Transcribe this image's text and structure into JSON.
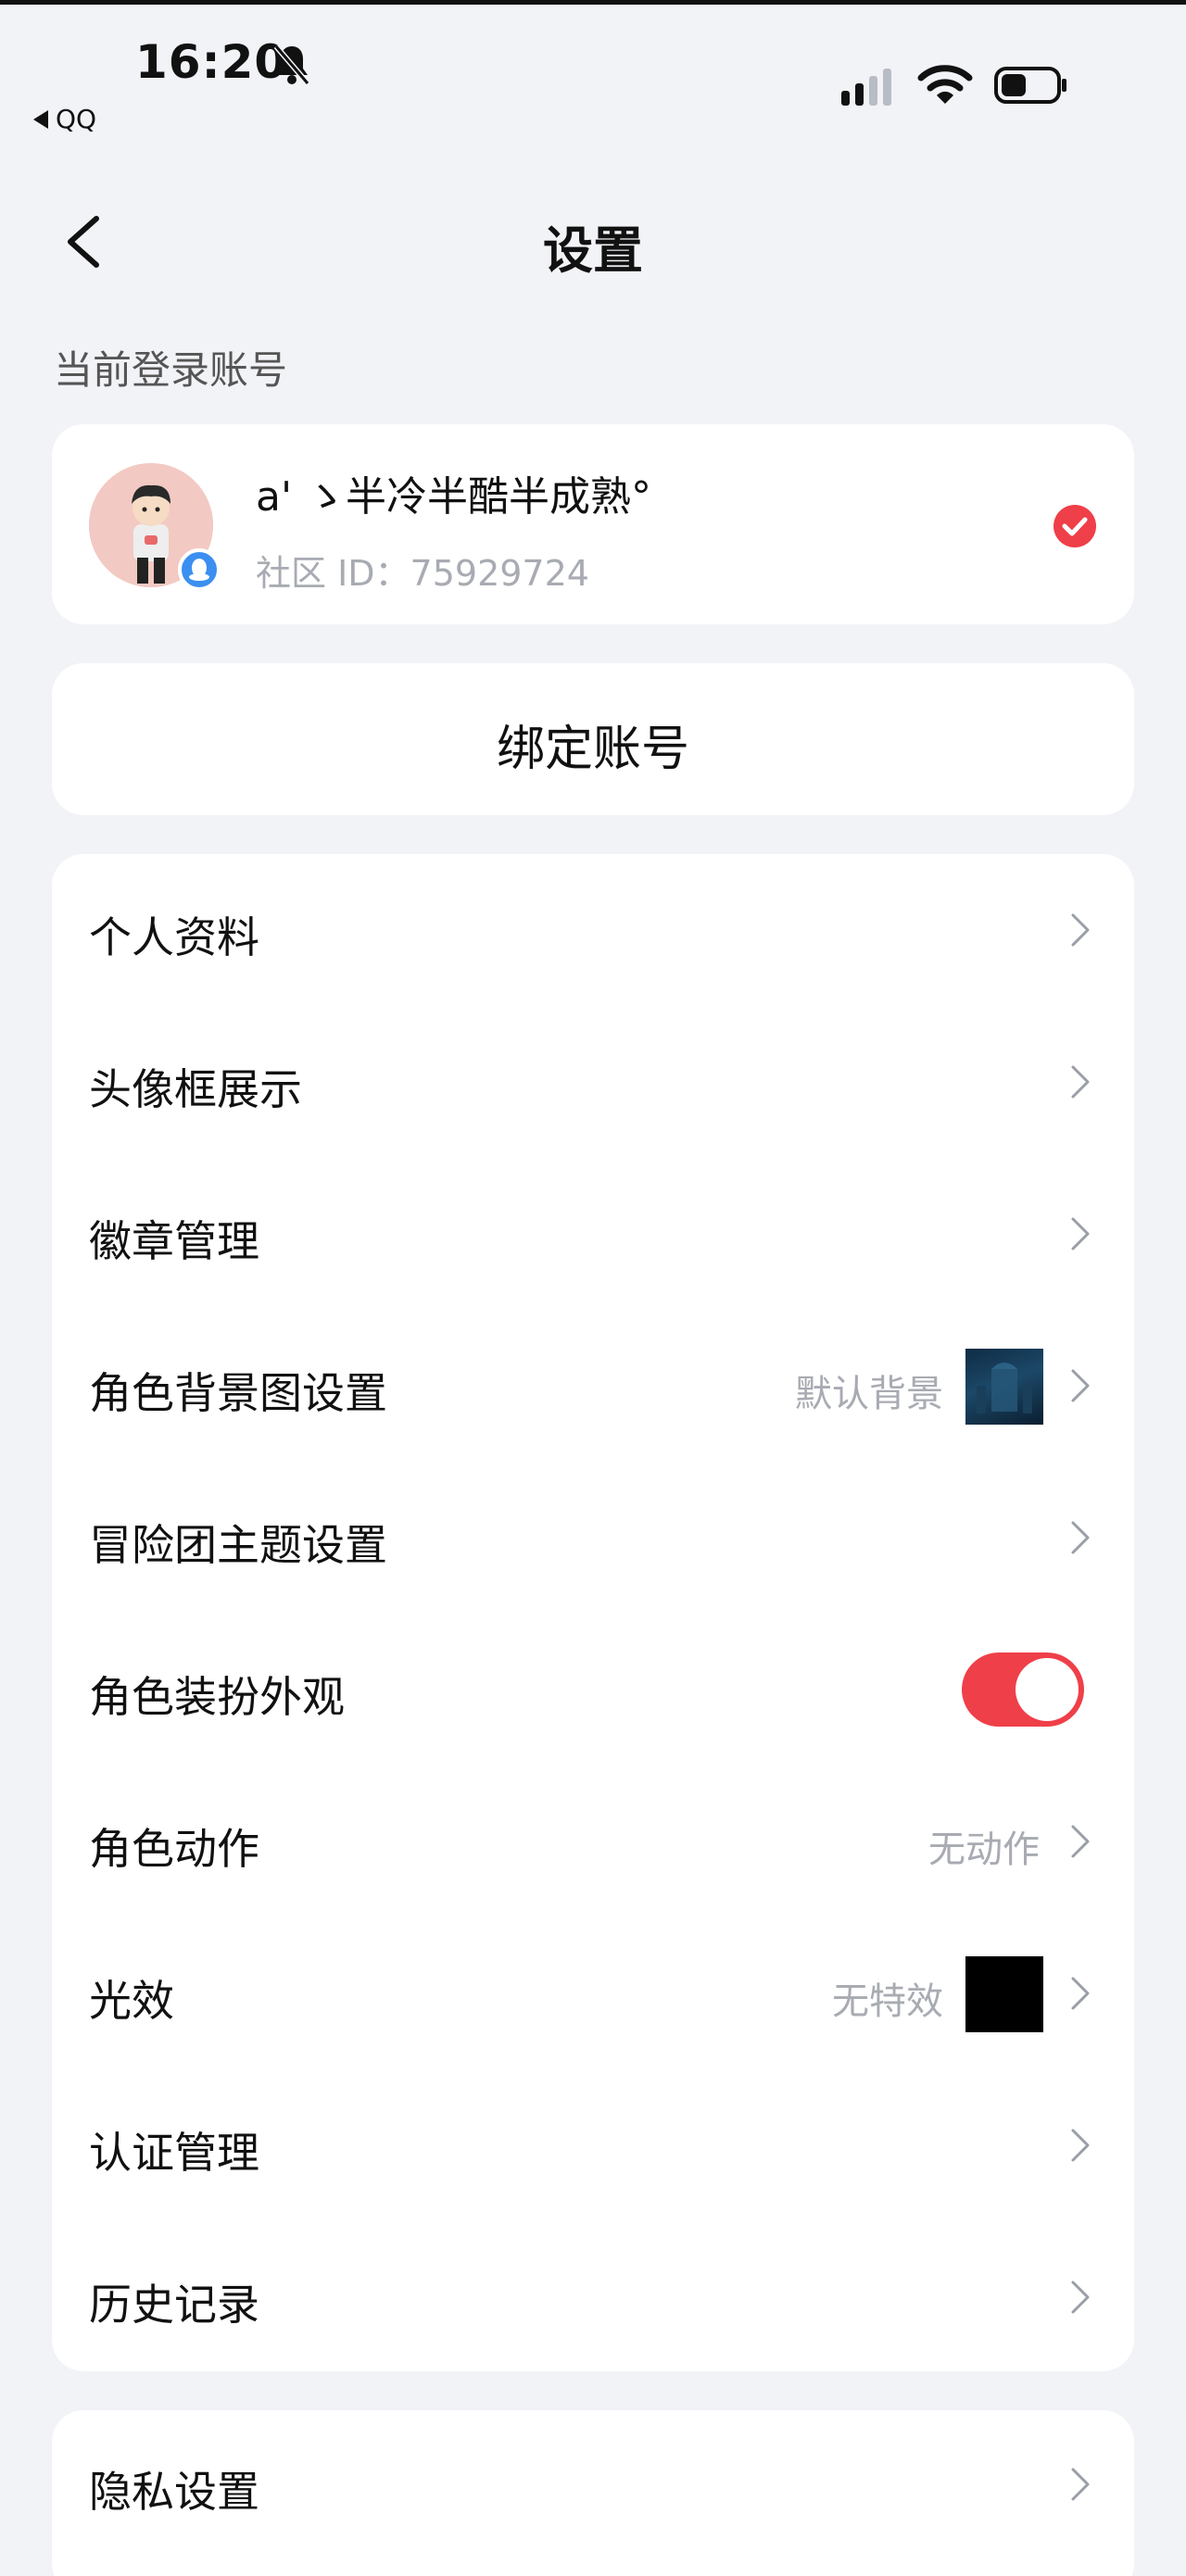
{
  "status_bar": {
    "time": "16:20",
    "back_app": "QQ"
  },
  "header": {
    "title": "设置"
  },
  "account_section": {
    "label": "当前登录账号",
    "name": "a' ゝ半冷半酷半成熟°",
    "id_text": "社区 ID：75929724"
  },
  "bind": {
    "label": "绑定账号"
  },
  "settings": {
    "items": [
      {
        "label": "个人资料"
      },
      {
        "label": "头像框展示"
      },
      {
        "label": "徽章管理"
      },
      {
        "label": "角色背景图设置",
        "value": "默认背景"
      },
      {
        "label": "冒险团主题设置"
      },
      {
        "label": "角色装扮外观",
        "toggle": true
      },
      {
        "label": "角色动作",
        "value": "无动作"
      },
      {
        "label": "光效",
        "value": "无特效"
      },
      {
        "label": "认证管理"
      },
      {
        "label": "历史记录"
      }
    ]
  },
  "privacy": {
    "label": "隐私设置"
  },
  "colors": {
    "accent": "#ef3f49",
    "background": "#f2f3f7",
    "muted_text": "#a8abb2"
  }
}
